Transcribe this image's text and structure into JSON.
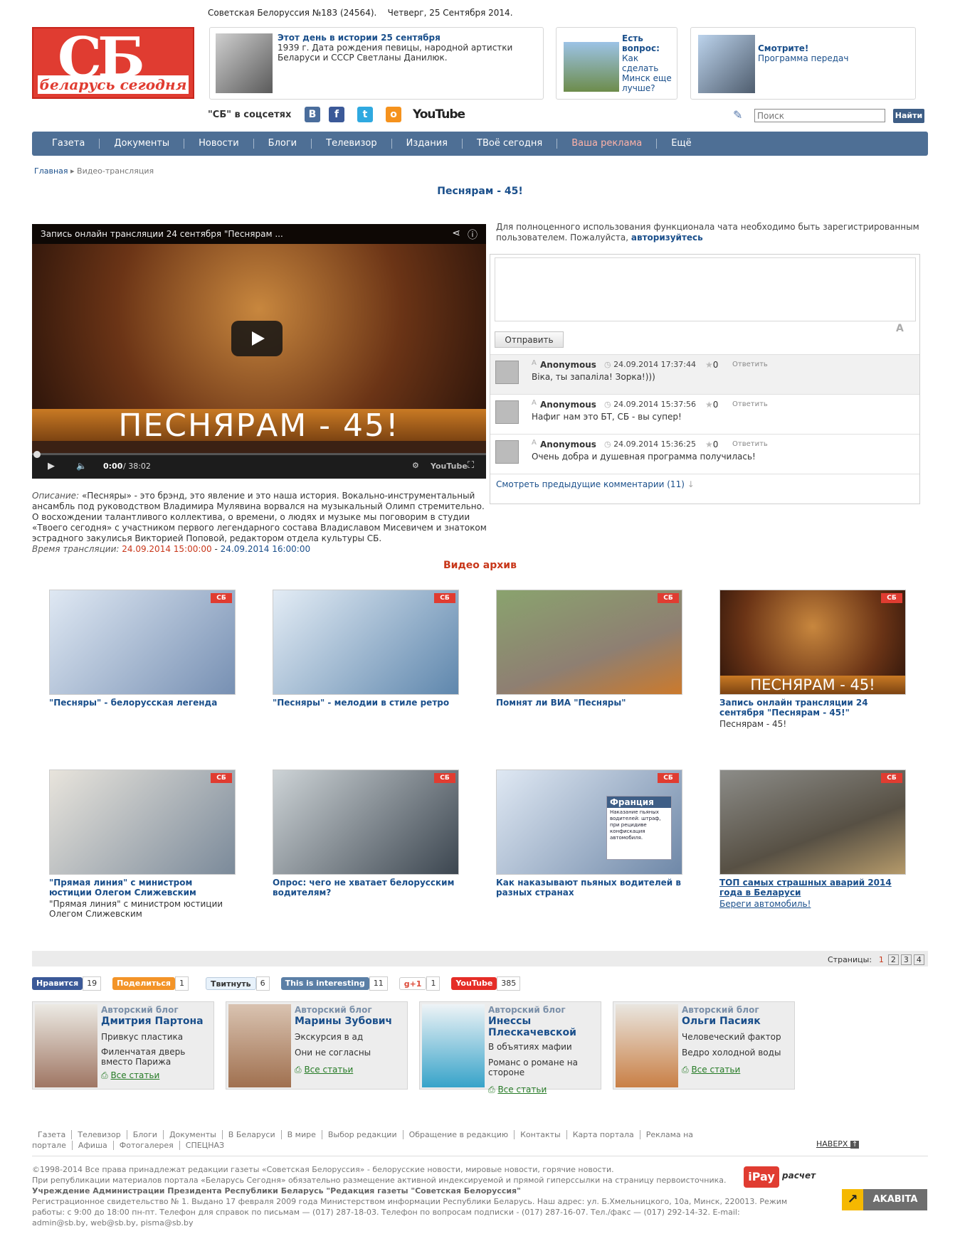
{
  "header": {
    "issue": "Советская Белоруссия №183 (24564).",
    "date": "Четверг, 25 Сентября 2014.",
    "logo_top": "СБ",
    "logo_bottom": "беларусь сегодня"
  },
  "promo": {
    "history_title": "Этот день в истории 25 сентября",
    "history_text": "1939 г. Дата рождения певицы, народной артистки Беларуси и СССР Светланы Данилюк.",
    "question_title": "Есть вопрос:",
    "question_text": "Как сделать Минск еще лучше?",
    "watch_title": "Смотрите!",
    "watch_text": "Программа передач"
  },
  "social": {
    "label": "\"СБ\" в соцсетях",
    "vk": "В",
    "fb": "f",
    "tw": "t",
    "ok": "о",
    "yt": "YouTube"
  },
  "search": {
    "placeholder": "Поиск",
    "button": "Найти"
  },
  "nav": [
    "Газета",
    "Документы",
    "Новости",
    "Блоги",
    "Телевизор",
    "Издания",
    "ТВоё сегодня",
    "Ваша реклама",
    "Ещё"
  ],
  "breadcrumb": {
    "home": "Главная",
    "current": "Видео-трансляция"
  },
  "page_title": "Песнярам - 45!",
  "video": {
    "title": "Запись онлайн трансляции 24 сентября \"Песнярам ...",
    "banner": "ПЕСНЯРАМ - 45!",
    "time": "0:00",
    "duration": "/ 38:02",
    "yt": "YouTube"
  },
  "description": {
    "label": "Описание:",
    "text": "«Песняры» - это брэнд, это явление и это наша история. Вокально-инструментальный ансамбль под руководством Владимира Мулявина ворвался на музыкальный Олимп стремительно. О восхождении талантливого коллектива, о времени, о людях и музыке мы поговорим в студии «Твоего сегодня» с участником первого легендарного состава Владиславом Мисевичем и знатоком эстрадного закулисья Викторией Поповой, редактором отдела культуры СБ.",
    "time_label": "Время трансляции:",
    "start": "24.09.2014 15:00:00",
    "dash": "-",
    "end": "24.09.2014 16:00:00"
  },
  "chat": {
    "note": "Для полноценного использования функционала чата необходимо быть зарегистрированным пользователем. Пожалуйста,",
    "login": "авторизуйтесь",
    "font_icon": "A",
    "send": "Отправить",
    "comments": [
      {
        "icon": "A",
        "name": "Anonymous",
        "date": "24.09.2014 17:37:44",
        "rating": "0",
        "reply": "Ответить",
        "text": "Віка, ты запаліла! Зорка!)))"
      },
      {
        "icon": "A",
        "name": "Anonymous",
        "date": "24.09.2014 15:37:56",
        "rating": "0",
        "reply": "Ответить",
        "text": "Нафиг нам это БТ, СБ - вы супер!"
      },
      {
        "icon": "A",
        "name": "Anonymous",
        "date": "24.09.2014 15:36:25",
        "rating": "0",
        "reply": "Ответить",
        "text": "Очень добра и душевная программа получилась!"
      }
    ],
    "more": "Смотреть предыдущие комментарии (11)"
  },
  "archive": {
    "title": "Видео архив",
    "badge": "СБ",
    "items": [
      {
        "caption": "\"Песняры\" - белорусская легенда",
        "sub": ""
      },
      {
        "caption": "\"Песняры\" - мелодии в стиле ретро",
        "sub": ""
      },
      {
        "caption": "Помнят ли ВИА \"Песняры\"",
        "sub": ""
      },
      {
        "caption": "Запись онлайн трансляции 24 сентября \"Песнярам - 45!\"",
        "sub": "Песнярам - 45!",
        "overlay": "ПЕСНЯРАМ - 45!"
      },
      {
        "caption": "\"Прямая линия\" с министром юстиции Олегом Слижевским",
        "sub": "\"Прямая линия\" с министром юстиции Олегом Слижевским"
      },
      {
        "caption": "Опрос: чего не хватает белорусским водителям?",
        "sub": ""
      },
      {
        "caption": "Как наказывают пьяных водителей в разных странах",
        "sub": "",
        "overlay_title": "Франция",
        "overlay_text": "Наказание пьяных водителей: штраф, при рецидиве конфискация автомобиля."
      },
      {
        "caption": "ТОП самых страшных аварий 2014 года в Беларуси",
        "sub": "Береги автомобиль!"
      }
    ]
  },
  "pagination": {
    "label": "Страницы:",
    "pages": [
      "1",
      "2",
      "3",
      "4"
    ]
  },
  "share": {
    "fb": "Нравится",
    "fb_count": "19",
    "ok": "Поделиться",
    "ok_count": "1",
    "tw": "Твитнуть",
    "tw_count": "6",
    "vk": "This is interesting",
    "vk_count": "11",
    "gp": "g+1",
    "gp_count": "1",
    "yt": "YouTube",
    "yt_count": "385"
  },
  "blogs": [
    {
      "tag": "Авторский блог",
      "name": "Дмитрия Партона",
      "l1": "Привкус пластика",
      "l2": "Филенчатая дверь вместо Парижа",
      "all": "Все статьи"
    },
    {
      "tag": "Авторский блог",
      "name": "Марины Зубович",
      "l1": "Экскурсия в ад",
      "l2": "Они не согласны",
      "all": "Все статьи"
    },
    {
      "tag": "Авторский блог",
      "name": "Инессы Плескачевской",
      "l1": "В объятиях мафии",
      "l2": "Романс о романе на стороне",
      "all": "Все статьи"
    },
    {
      "tag": "Авторский блог",
      "name": "Ольги Пасияк",
      "l1": "Человеческий фактор",
      "l2": "Ведро холодной воды",
      "all": "Все статьи"
    }
  ],
  "footer": {
    "links": [
      "Газета",
      "Телевизор",
      "Блоги",
      "Документы",
      "В Беларуси",
      "В мире",
      "Выбор редакции",
      "Обращение в редакцию",
      "Контакты",
      "Карта портала",
      "Реклама на портале",
      "Афиша",
      "Фотогалерея",
      "СПЕЦНАЗ"
    ],
    "top": "НАВЕРХ",
    "copy1": "©1998-2014 Все права принадлежат редакции газеты «Советская Белоруссия» - белорусские новости, мировые новости, горячие новости.",
    "copy2": "При републикации материалов портала «Беларусь Сегодня» обязательно размещение активной индексируемой и прямой гиперссылки на страницу первоисточника.",
    "copy3": "Учреждение Администрации Президента Республики Беларусь \"Редакция газеты \"Советская Белоруссия\"",
    "copy4": "Регистрационное свидетельство № 1. Выдано 17 февраля 2009 года Министерством информации Республики Беларусь. Наш адрес: ул. Б.Хмельницкого, 10а, Минск, 220013. Режим работы: с 9:00 до 18:00 пн-пт. Телефон для справок по письмам — (017) 287-18-03. Телефон по вопросам подписки - (017) 287-16-07. Тел./факс — (017) 292-14-32. E-mail: admin@sb.by, web@sb.by, pisma@sb.by",
    "ipay": "iPay",
    "raschet": "расчет",
    "akavita": "AKABITA"
  }
}
